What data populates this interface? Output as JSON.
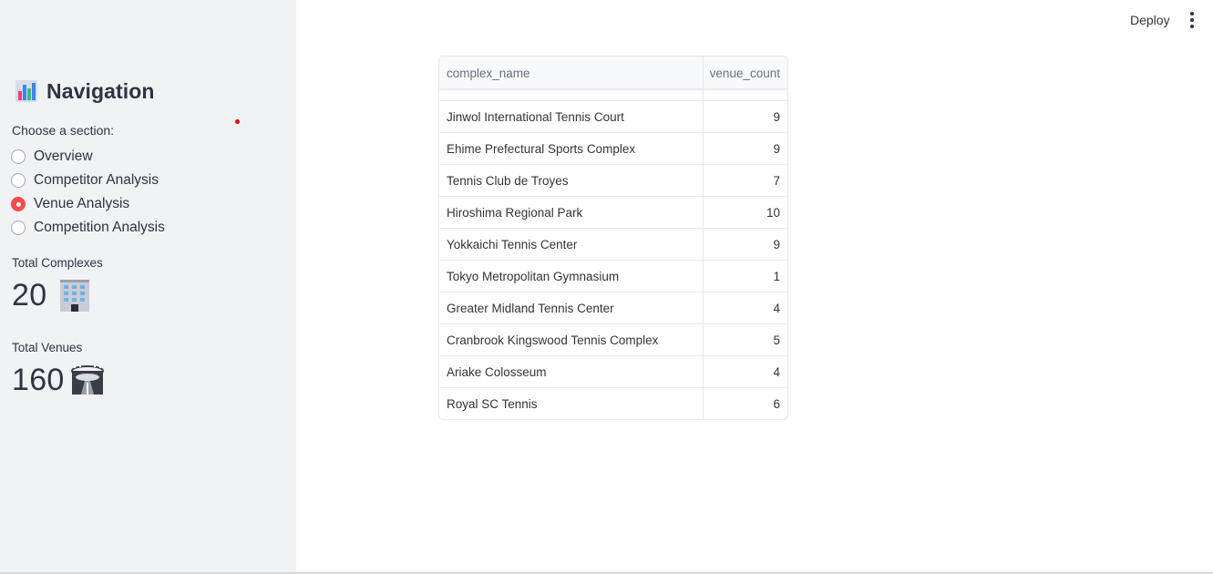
{
  "sidebar": {
    "title": "Navigation",
    "title_icon": "bar-chart-emoji-icon",
    "radio_caption": "Choose a section:",
    "options": [
      {
        "label": "Overview",
        "selected": false
      },
      {
        "label": "Competitor Analysis",
        "selected": false
      },
      {
        "label": "Venue Analysis",
        "selected": true
      },
      {
        "label": "Competition Analysis",
        "selected": false
      }
    ],
    "metrics": [
      {
        "label": "Total Complexes",
        "value": "20",
        "icon": "office-building-emoji-icon"
      },
      {
        "label": "Total Venues",
        "value": "160",
        "icon": "stadium-emoji-icon"
      }
    ]
  },
  "header": {
    "deploy_label": "Deploy",
    "menu_icon": "vertical-ellipsis-icon"
  },
  "table": {
    "columns": [
      "complex_name",
      "venue_count"
    ],
    "rows": [
      [
        "",
        ""
      ],
      [
        "Jinwol International Tennis Court",
        "9"
      ],
      [
        "Ehime Prefectural Sports Complex",
        "9"
      ],
      [
        "Tennis Club de Troyes",
        "7"
      ],
      [
        "Hiroshima Regional Park",
        "10"
      ],
      [
        "Yokkaichi Tennis Center",
        "9"
      ],
      [
        "Tokyo Metropolitan Gymnasium",
        "1"
      ],
      [
        "Greater Midland Tennis Center",
        "4"
      ],
      [
        "Cranbrook Kingswood Tennis Complex",
        "5"
      ],
      [
        "Ariake Colosseum",
        "4"
      ],
      [
        "Royal SC Tennis",
        "6"
      ]
    ]
  },
  "colors": {
    "accent": "#ff4b4b",
    "sidebar_bg": "#f0f2f6",
    "text": "#31333f"
  }
}
